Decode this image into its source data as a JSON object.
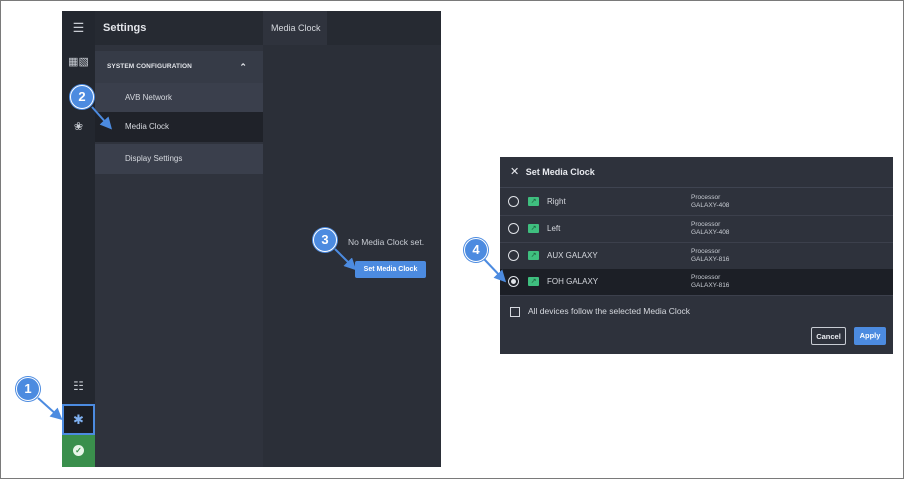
{
  "app": {
    "settings_title": "Settings",
    "content_tab": "Media Clock",
    "system_config_label": "SYSTEM CONFIGURATION",
    "menu": [
      {
        "label": "AVB Network"
      },
      {
        "label": "Media Clock"
      },
      {
        "label": "Display Settings"
      }
    ],
    "no_clock_text": "No Media Clock set.",
    "set_button": "Set Media Clock"
  },
  "callouts": [
    "1",
    "2",
    "3",
    "4"
  ],
  "dialog": {
    "title": "Set Media Clock",
    "rows": [
      {
        "name": "Right",
        "proc_line1": "Processor",
        "proc_line2": "GALAXY-408",
        "selected": false
      },
      {
        "name": "Left",
        "proc_line1": "Processor",
        "proc_line2": "GALAXY-408",
        "selected": false
      },
      {
        "name": "AUX GALAXY",
        "proc_line1": "Processor",
        "proc_line2": "GALAXY-816",
        "selected": false
      },
      {
        "name": "FOH GALAXY",
        "proc_line1": "Processor",
        "proc_line2": "GALAXY-816",
        "selected": true
      }
    ],
    "follow_label": "All devices follow the selected Media Clock",
    "cancel": "Cancel",
    "apply": "Apply"
  },
  "colors": {
    "accent": "#4c8be0",
    "status_green": "#3a8f4c",
    "panel": "#2e323c"
  }
}
